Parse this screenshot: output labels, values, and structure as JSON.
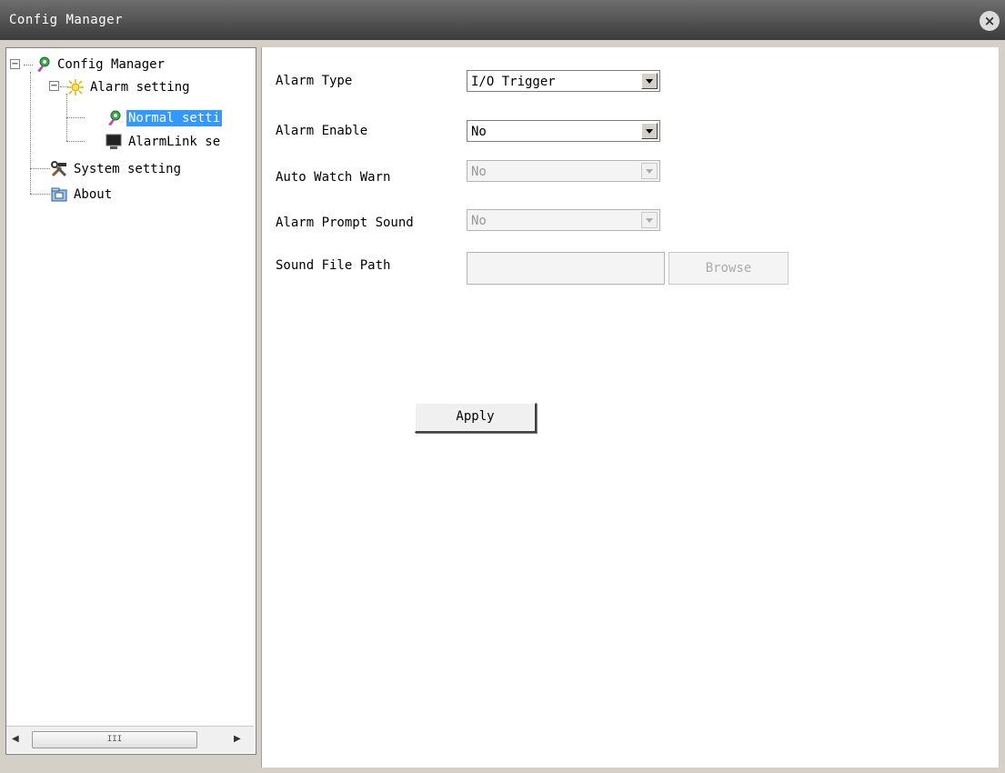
{
  "window": {
    "title": "Config Manager",
    "close_icon": "close-circle-icon"
  },
  "tree": {
    "nodes": [
      {
        "label": "Config Manager",
        "icon": "config-gear-icon",
        "expanded": true
      },
      {
        "label": "Alarm setting",
        "icon": "alarm-light-icon",
        "expanded": true
      },
      {
        "label": "Normal setti",
        "icon": "normal-setting-icon",
        "selected": true
      },
      {
        "label": "AlarmLink se",
        "icon": "monitor-icon"
      },
      {
        "label": "System setting",
        "icon": "tools-icon"
      },
      {
        "label": "About",
        "icon": "about-icon"
      }
    ],
    "scrollbar": {
      "thumb_glyph": "III"
    }
  },
  "form": {
    "alarm_type": {
      "label": "Alarm Type",
      "value": "I/O Trigger"
    },
    "alarm_enable": {
      "label": "Alarm Enable",
      "value": "No"
    },
    "auto_watch_warn": {
      "label": "Auto Watch Warn",
      "value": "No",
      "disabled": true
    },
    "alarm_prompt_sound": {
      "label": "Alarm Prompt Sound",
      "value": "No",
      "disabled": true
    },
    "sound_file_path": {
      "label": "Sound File Path",
      "value": "",
      "disabled": true
    },
    "browse_button": "Browse",
    "apply_button": "Apply"
  }
}
